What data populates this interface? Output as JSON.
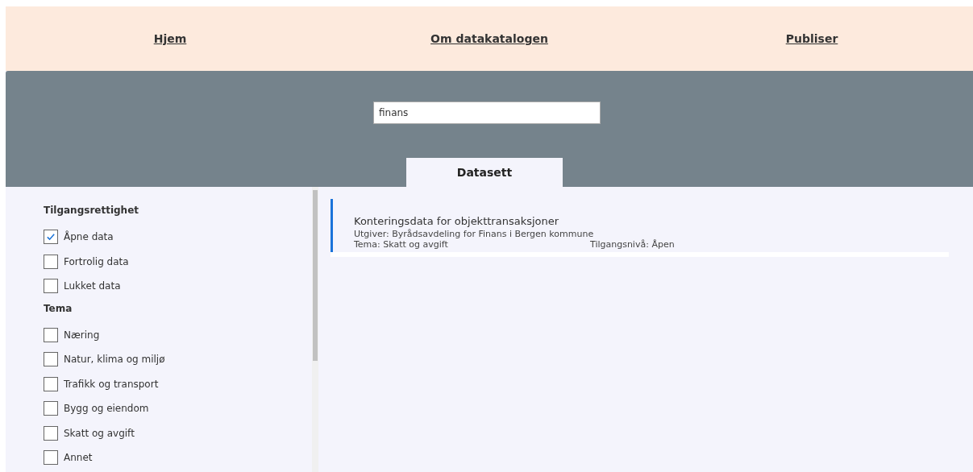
{
  "nav": [
    {
      "label": "Hjem"
    },
    {
      "label": "Om datakatalogen"
    },
    {
      "label": "Publiser"
    }
  ],
  "search": {
    "value": "finans"
  },
  "tabs": [
    {
      "label": "Datasett",
      "selected": true
    }
  ],
  "filters": [
    {
      "heading": "Tilgangsrettighet",
      "options": [
        {
          "label": "Åpne data",
          "checked": true
        },
        {
          "label": "Fortrolig data",
          "checked": false
        },
        {
          "label": "Lukket data",
          "checked": false
        }
      ]
    },
    {
      "heading": "Tema",
      "options": [
        {
          "label": "Næring",
          "checked": false
        },
        {
          "label": "Natur, klima og miljø",
          "checked": false
        },
        {
          "label": "Trafikk og transport",
          "checked": false
        },
        {
          "label": "Bygg og eiendom",
          "checked": false
        },
        {
          "label": "Skatt og avgift",
          "checked": false
        },
        {
          "label": "Annet",
          "checked": false
        }
      ]
    }
  ],
  "results": [
    {
      "title": "Konteringsdata for objekttransaksjoner",
      "publisher": "Utgiver: Byrådsavdeling for Finans i Bergen kommune",
      "theme": "Tema: Skatt og avgift",
      "access": "Tilgangsnivå: Åpen"
    }
  ]
}
